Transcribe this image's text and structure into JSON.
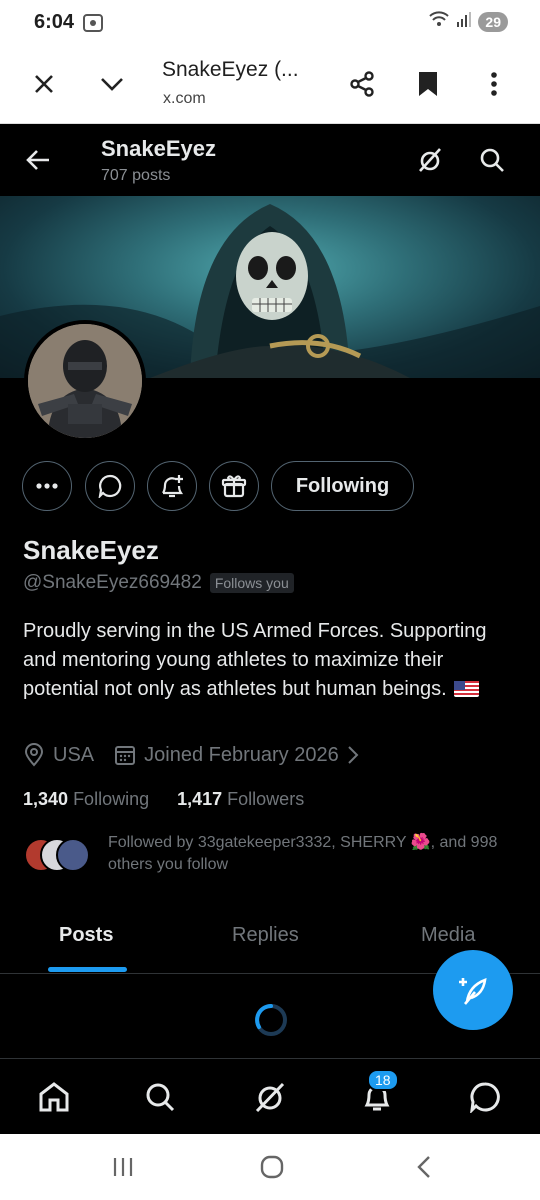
{
  "status_bar": {
    "time": "6:04",
    "battery": "29"
  },
  "browser": {
    "title": "SnakeEyez (...",
    "url": "x.com"
  },
  "header": {
    "name": "SnakeEyez",
    "posts_count": "707 posts"
  },
  "profile": {
    "following_button": "Following",
    "display_name": "SnakeEyez",
    "handle": "@SnakeEyez669482",
    "follows_you_badge": "Follows you",
    "bio": "Proudly serving in the US Armed Forces. Supporting and mentoring young athletes to maximize their potential not only as athletes but human beings.",
    "location": "USA",
    "joined": "Joined February 2026",
    "following_count": "1,340",
    "following_label": "Following",
    "followers_count": "1,417",
    "followers_label": "Followers",
    "followed_by": "Followed by 33gatekeeper3332, SHERRY 🌺, and 998 others you follow"
  },
  "tabs": [
    {
      "label": "Posts",
      "active": true
    },
    {
      "label": "Replies",
      "active": false
    },
    {
      "label": "Media",
      "active": false
    }
  ],
  "bottom_nav": {
    "notification_badge": "18"
  },
  "colors": {
    "accent": "#1d9bf0",
    "background": "#000000",
    "muted_text": "#71767b"
  }
}
